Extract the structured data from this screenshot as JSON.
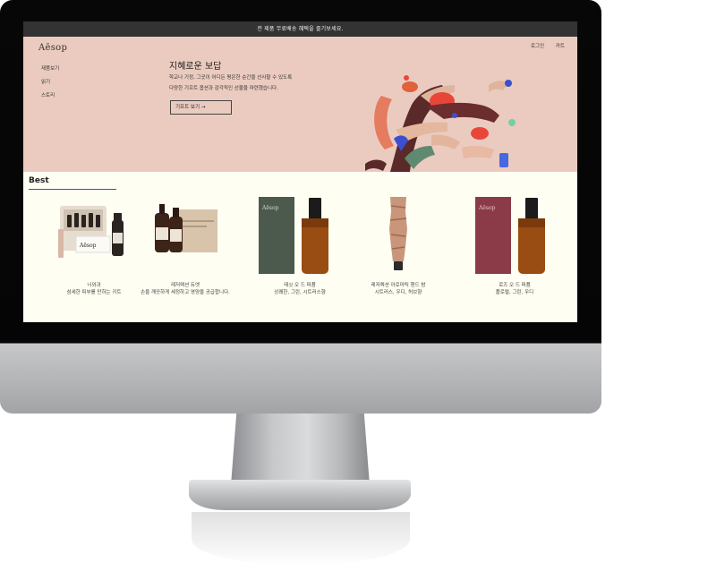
{
  "announcement": "전 제품 무료배송 혜택을 즐기보세요.",
  "brand": "Aēsop",
  "nav": [
    {
      "label": "제품보기"
    },
    {
      "label": "읽기"
    },
    {
      "label": "스토리"
    }
  ],
  "utility": {
    "login": "로그인",
    "cart": "카트"
  },
  "hero": {
    "title": "지혜로운 보답",
    "line1": "학교나 기정, 그곳이 어디든 평온한 순간을 선사할 수 있도록",
    "line2": "다양한 기프트 옵션과 감각적인 선물을 마련했습니다.",
    "button": "기프트 보기 →"
  },
  "best": {
    "title": "Best",
    "products": [
      {
        "name": "너와과",
        "desc": "섬세한 피부를 만하는 키트",
        "bottle_color": "#2b2320",
        "box_color": "#e6ddd0"
      },
      {
        "name": "레저렉션 듀엣",
        "desc": "손을 깨끗하게 세정하고 영양을 공급합니다.",
        "bottle_color": "#3c2418",
        "box_color": "#d8c3ab"
      },
      {
        "name": "테싯 오 드 퍼퓸",
        "desc": "상쾌한, 그린, 시트러스향",
        "bottle_color": "#9a4d12",
        "box_color": "#4c5a4e",
        "box_label": "Aēsop"
      },
      {
        "name": "레저렉션 아로마틱 핸드 밤",
        "desc": "시트러스, 우디, 허브향",
        "bottle_color": "#c9967b",
        "box_color": "#d9b7a5"
      },
      {
        "name": "로즈 오 드 퍼퓸",
        "desc": "플로럴, 그린, 우디",
        "bottle_color": "#9a4d12",
        "box_color": "#8b3a48",
        "box_label": "Aēsop"
      }
    ]
  },
  "colors": {
    "announce_bg": "#333333",
    "hero_bg": "#ebcbbf",
    "best_bg": "#fefef2",
    "bezel": "#050505",
    "chin": "#b4b5b7"
  }
}
